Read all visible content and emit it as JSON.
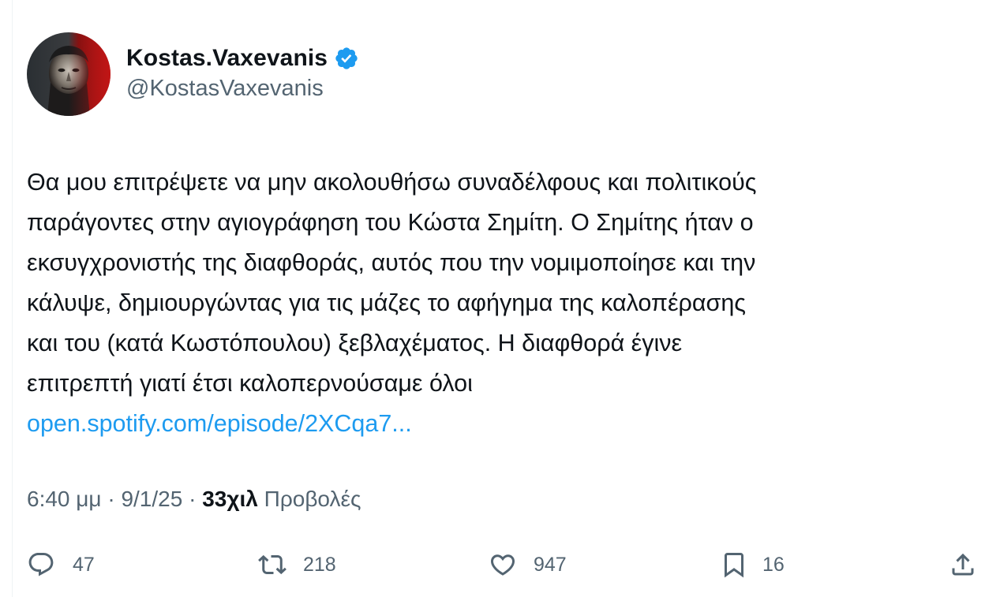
{
  "author": {
    "display_name": "Kostas.Vaxevanis",
    "handle": "@KostasVaxevanis",
    "verified": true,
    "verified_color": "#1d9bf0"
  },
  "tweet": {
    "lines": [
      "Θα μου επιτρέψετε να μην ακολουθήσω συναδέλφους και πολιτικούς",
      "παράγοντες στην αγιογράφηση του Κώστα Σημίτη. Ο Σημίτης ήταν ο",
      "εκσυγχρονιστής της διαφθοράς, αυτός που την νομιμοποίησε και την",
      "κάλυψε, δημιουργώντας για τις μάζες το αφήγημα της καλοπέρασης",
      "και του (κατά Κωστόπουλου) ξεβλαχέματος. Η διαφθορά έγινε",
      "επιτρεπτή γιατί έτσι καλοπερνούσαμε όλοι"
    ],
    "link_text": "open.spotify.com/episode/2XCqa7...",
    "link_color": "#1d9bf0"
  },
  "meta": {
    "time": "6:40 μμ",
    "separator": " · ",
    "date": "9/1/25",
    "views_count": "33χιλ",
    "views_label": "Προβολές"
  },
  "actions": {
    "replies": "47",
    "retweets": "218",
    "likes": "947",
    "bookmarks": "16"
  },
  "icons": {
    "reply": "reply-icon",
    "retweet": "retweet-icon",
    "like": "heart-icon",
    "bookmark": "bookmark-icon",
    "share": "share-icon",
    "verified": "verified-badge-icon"
  },
  "colors": {
    "text": "#0f1419",
    "secondary": "#536471",
    "accent": "#1d9bf0"
  }
}
